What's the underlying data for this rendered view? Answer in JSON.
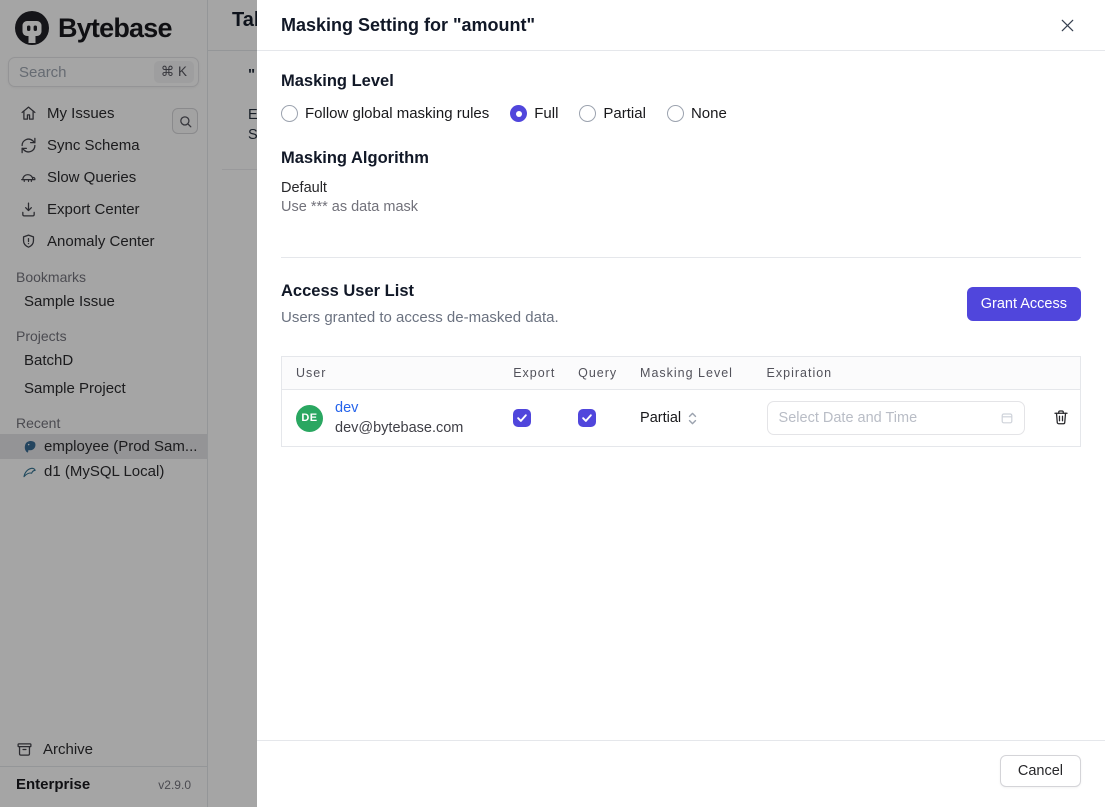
{
  "sidebar": {
    "logo_text": "Bytebase",
    "search": {
      "placeholder": "Search",
      "shortcut": "⌘ K"
    },
    "nav": [
      {
        "label": "My Issues",
        "icon": "home-icon"
      },
      {
        "label": "Sync Schema",
        "icon": "sync-icon"
      },
      {
        "label": "Slow Queries",
        "icon": "turtle-icon"
      },
      {
        "label": "Export Center",
        "icon": "download-icon"
      },
      {
        "label": "Anomaly Center",
        "icon": "shield-icon"
      }
    ],
    "sections": {
      "bookmarks": {
        "title": "Bookmarks",
        "items": [
          {
            "label": "Sample Issue"
          }
        ]
      },
      "projects": {
        "title": "Projects",
        "items": [
          {
            "label": "BatchD"
          },
          {
            "label": "Sample Project"
          }
        ]
      },
      "recent": {
        "title": "Recent",
        "items": [
          {
            "label": "employee (Prod Sam...",
            "icon": "postgres-icon",
            "selected": true
          },
          {
            "label": "d1 (MySQL Local)",
            "icon": "mysql-icon",
            "selected": false
          }
        ]
      }
    },
    "archive_label": "Archive",
    "plan": "Enterprise",
    "version": "v2.9.0"
  },
  "background_page": {
    "title": "Tab",
    "fragments": {
      "quote": "\"",
      "e": "E",
      "s": "S"
    }
  },
  "modal": {
    "title": "Masking Setting for \"amount\"",
    "masking_level": {
      "heading": "Masking Level",
      "options": [
        {
          "label": "Follow global masking rules",
          "selected": false
        },
        {
          "label": "Full",
          "selected": true
        },
        {
          "label": "Partial",
          "selected": false
        },
        {
          "label": "None",
          "selected": false
        }
      ]
    },
    "masking_algorithm": {
      "heading": "Masking Algorithm",
      "name": "Default",
      "description": "Use *** as data mask"
    },
    "access": {
      "heading": "Access User List",
      "subtitle": "Users granted to access de-masked data.",
      "grant_button": "Grant Access"
    },
    "table": {
      "columns": [
        "User",
        "Export",
        "Query",
        "Masking Level",
        "Expiration"
      ],
      "rows": [
        {
          "avatar_initials": "DE",
          "name": "dev",
          "email": "dev@bytebase.com",
          "export_checked": true,
          "query_checked": true,
          "masking_level": "Partial",
          "expiration_value": "",
          "expiration_placeholder": "Select Date and Time"
        }
      ]
    },
    "footer": {
      "cancel_label": "Cancel"
    }
  },
  "colors": {
    "accent": "#5046dc",
    "link": "#2563eb",
    "avatar_green": "#2aa761",
    "postgres_blue": "#336791",
    "mysql_teal": "#00758f",
    "overlay": "rgba(10,10,12,0.37)"
  }
}
